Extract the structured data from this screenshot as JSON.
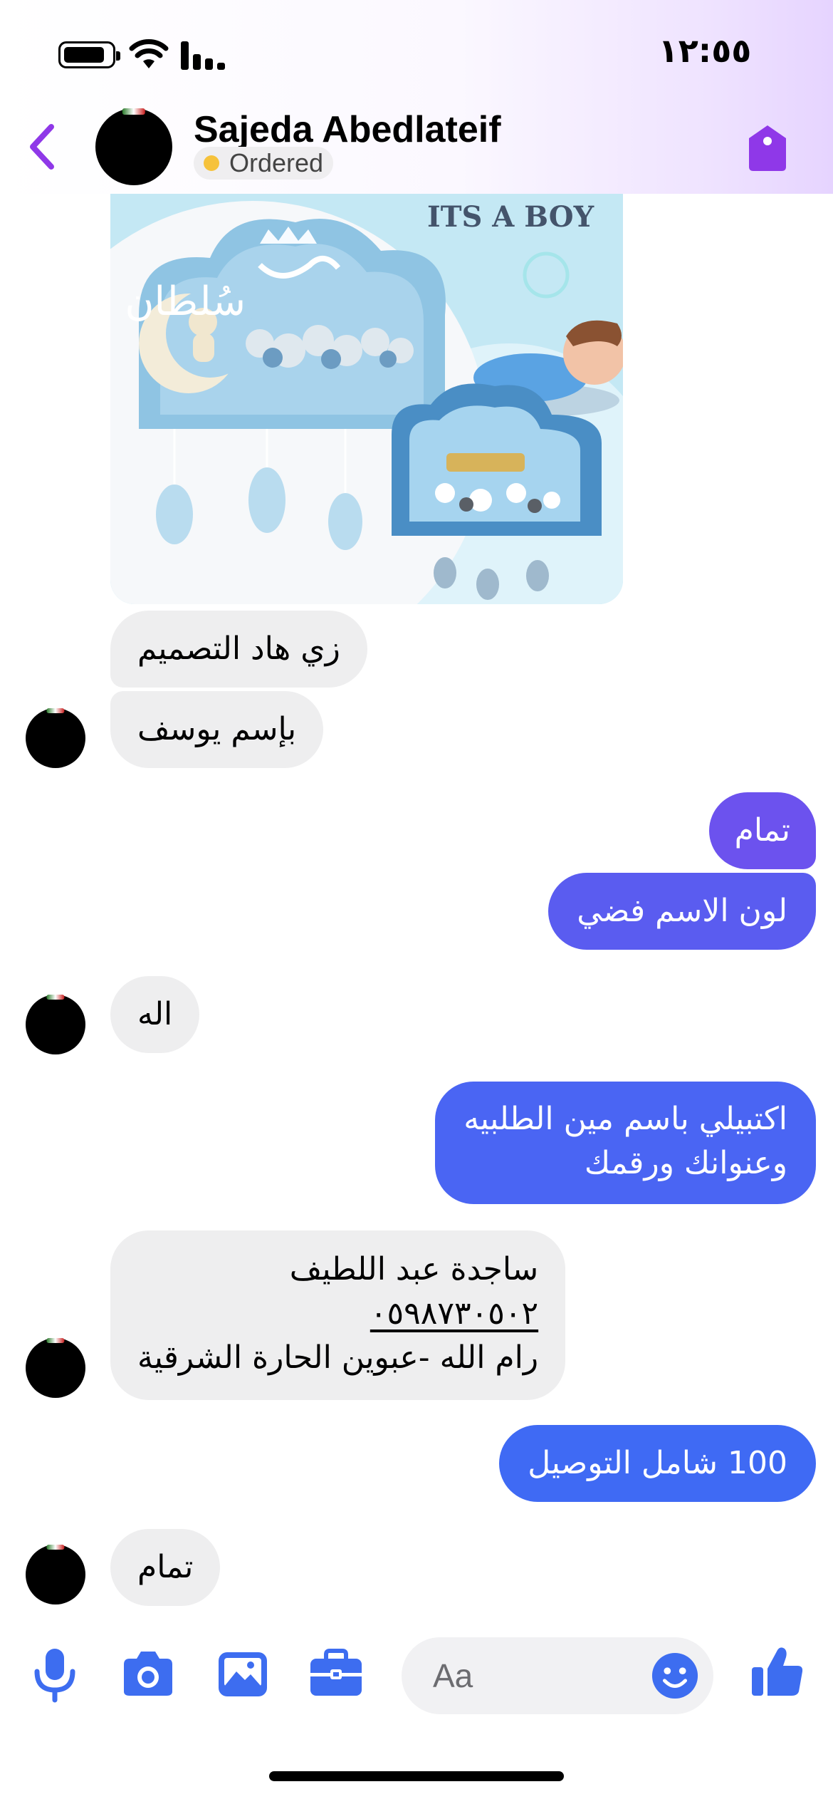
{
  "status_bar": {
    "time": "١٢:٥٥"
  },
  "header": {
    "contact_name": "Sajeda Abedlateif",
    "status_label": "Ordered"
  },
  "photo": {
    "banner_text": "ITS A BOY",
    "main_name_text": "سُلطان"
  },
  "messages": [
    {
      "side": "incoming",
      "text": "زي هاد التصميم"
    },
    {
      "side": "incoming",
      "text": "بإسم يوسف"
    },
    {
      "side": "outgoing",
      "text": "تمام"
    },
    {
      "side": "outgoing",
      "text": "لون الاسم فضي"
    },
    {
      "side": "incoming",
      "text": "اله"
    },
    {
      "side": "outgoing",
      "lines": [
        "اكتبيلي باسم مين الطلبيه",
        "وعنوانك ورقمك"
      ]
    },
    {
      "side": "incoming",
      "lines": [
        "ساجدة عبد اللطيف",
        "٠٥٩٨٧٣٠٥٠٢",
        "رام الله -عبوين الحارة الشرقية"
      ]
    },
    {
      "side": "outgoing",
      "text": "100 شامل التوصيل"
    },
    {
      "side": "incoming",
      "text": "تمام"
    }
  ],
  "composer": {
    "placeholder": "Aa"
  },
  "colors": {
    "accent_purple": "#8f38e8",
    "bubble_blue": "#4a65f3",
    "bubble_purple": "#6c52ee",
    "incoming_bubble": "#eeeeef",
    "icon_blue": "#3d6df0"
  },
  "icons": [
    "battery-icon",
    "wifi-icon",
    "signal-icon",
    "back-chevron-icon",
    "tag-icon",
    "microphone-icon",
    "camera-icon",
    "gallery-icon",
    "briefcase-icon",
    "emoji-icon",
    "thumbs-up-icon"
  ]
}
